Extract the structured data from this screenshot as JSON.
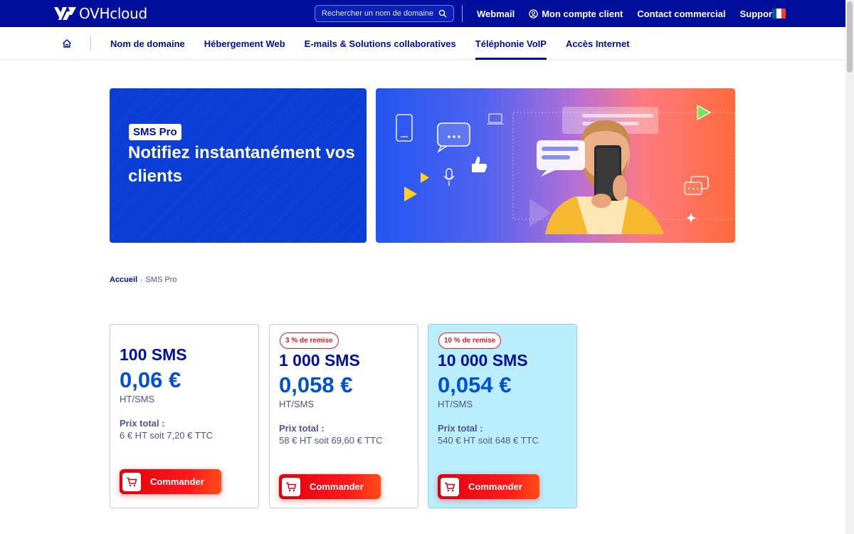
{
  "header": {
    "logo_text": "OVHcloud",
    "search_placeholder": "Rechercher un nom de domaine",
    "links": [
      "Webmail",
      "Mon compte client",
      "Contact commercial",
      "Support"
    ],
    "colors": {
      "brand": "#000e9c",
      "accent": "#0050d7",
      "cta": "#e0000f"
    }
  },
  "nav": {
    "items": [
      "Nom de domaine",
      "Hébergement Web",
      "E-mails & Solutions collaboratives",
      "Téléphonie VoIP",
      "Accès Internet"
    ],
    "active": "Téléphonie VoIP"
  },
  "hero": {
    "badge": "SMS Pro",
    "title": "Notifiez instantanément vos clients"
  },
  "breadcrumb": {
    "home": "Accueil",
    "current": "SMS Pro"
  },
  "offers": [
    {
      "discount": "",
      "quantity": "100 SMS",
      "price": "0,06 €",
      "unit": "HT/SMS",
      "total_label": "Prix total :",
      "total_value": "6 € HT soit 7,20 € TTC",
      "button": "Commander"
    },
    {
      "discount": "3 % de remise",
      "quantity": "1 000 SMS",
      "price": "0,058 €",
      "unit": "HT/SMS",
      "total_label": "Prix total :",
      "total_value": "58 € HT soit 69,60 € TTC",
      "button": "Commander"
    },
    {
      "discount": "10 % de remise",
      "quantity": "10 000 SMS",
      "price": "0,054 €",
      "unit": "HT/SMS",
      "total_label": "Prix total :",
      "total_value": "540 € HT soit 648 € TTC",
      "button": "Commander"
    }
  ]
}
